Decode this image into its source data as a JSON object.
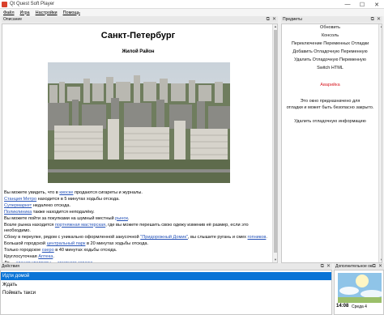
{
  "window": {
    "title": "Qt Quest Soft Player",
    "buttons": [
      "—",
      "☐",
      "✕"
    ]
  },
  "menu": [
    "Файл",
    "Игра",
    "Настройки",
    "Помощь"
  ],
  "description_pane": {
    "header": "Описание",
    "title": "Санкт-Петербург",
    "subtitle": "Жилой Район",
    "paragraphs": [
      [
        {
          "t": "Вы можете увидеть, что в "
        },
        {
          "t": "киоске",
          "link": true
        },
        {
          "t": " продаются сигареты и журналы."
        }
      ],
      [
        {
          "t": "Станция Метро",
          "link": true
        },
        {
          "t": " находится в 5 минутах ходьбы отсюда."
        }
      ],
      [
        {
          "t": "Супермаркет",
          "link": true
        },
        {
          "t": " недалеко отсюда."
        }
      ],
      [
        {
          "t": "Поликлиника",
          "link": true
        },
        {
          "t": " также находится неподалёку."
        }
      ],
      [
        {
          "t": "Вы можете пойти за покупками на шумный местный "
        },
        {
          "t": "рынок",
          "link": true
        },
        {
          "t": "."
        }
      ],
      [
        {
          "t": "Возле рынка находится "
        },
        {
          "t": "портняжная мастерская",
          "link": true
        },
        {
          "t": ", где вы можете перешить свою одежу изменив её размер, если это необходимо."
        }
      ],
      [
        {
          "t": "Сбоку в переулке, рядом с уникально оформленной закусочной "
        },
        {
          "t": "\"Придорожный Домик\"",
          "link": true
        },
        {
          "t": ", вы слышите ругань и смех "
        },
        {
          "t": "гопников",
          "link": true
        },
        {
          "t": "."
        }
      ],
      [
        {
          "t": "Большой городской "
        },
        {
          "t": "центральный парк",
          "link": true
        },
        {
          "t": " в 20 минутах ходьбы отсюда."
        }
      ],
      [
        {
          "t": "Только городское "
        },
        {
          "t": "озеро",
          "link": true
        },
        {
          "t": " в 40 минутах ходьбы отсюда."
        }
      ],
      [
        {
          "t": "Круглосуточная "
        },
        {
          "t": "Аптека",
          "link": true
        },
        {
          "t": "."
        }
      ],
      [
        {
          "t": "Ло ... "
        },
        {
          "t": "здания квартиры",
          "link": true
        },
        {
          "t": " ... "
        },
        {
          "t": "местного гаража",
          "link": true
        },
        {
          "t": "."
        }
      ]
    ]
  },
  "items_pane": {
    "header": "Предметы",
    "items": [
      {
        "label": "Обновить",
        "red": false
      },
      {
        "label": "Консоль",
        "red": false
      },
      {
        "label": "Переключение Переменных Отладки",
        "red": false
      },
      {
        "label": "Добавить Отладочную Переменную",
        "red": false
      },
      {
        "label": "Удалить Отладочную Переменную",
        "red": false
      },
      {
        "label": "Switch HTML",
        "red": false
      },
      {
        "label": "Аварийка",
        "red": true
      },
      {
        "label": "Это окно предназначено для",
        "red": false
      },
      {
        "label": "отладки и может быть безопасно закрыто.",
        "red": false
      },
      {
        "label": "Удалить отладочную информацию",
        "red": false
      }
    ]
  },
  "actions_pane": {
    "header": "Действия",
    "actions": [
      "Идти домой",
      "Ждать",
      "Поймать такси"
    ],
    "selected_index": 0
  },
  "extra_pane": {
    "header": "Дополнительное окно",
    "time": "14:08",
    "day": "Среда 4"
  },
  "colors": {
    "link": "#2653b8",
    "selection": "#0a74d6",
    "alert": "#d9222a"
  }
}
